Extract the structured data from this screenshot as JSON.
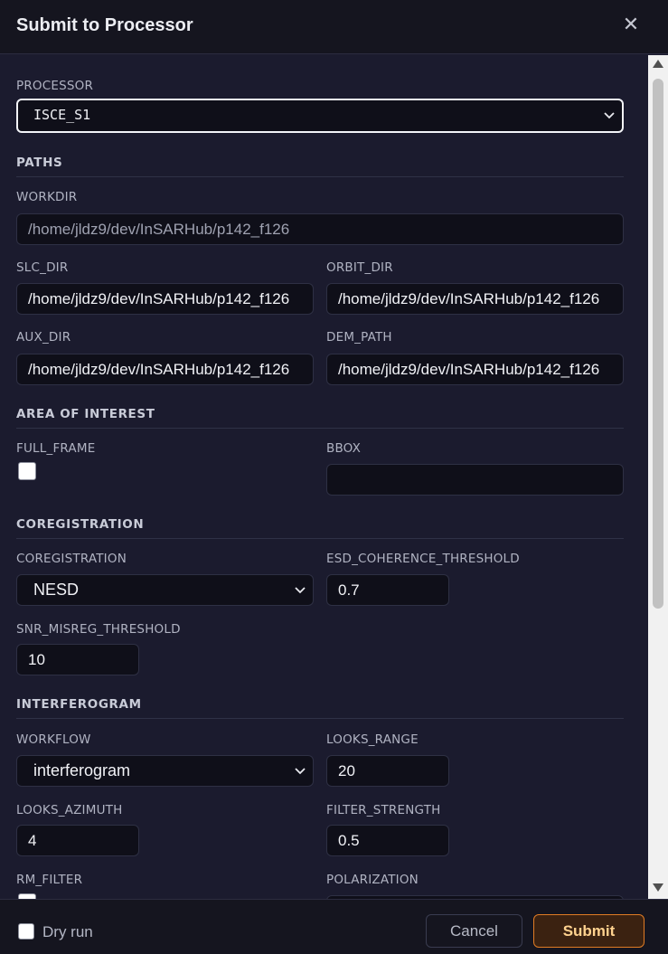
{
  "dialog": {
    "title": "Submit to Processor",
    "close_glyph": "✕"
  },
  "processor": {
    "label": "PROCESSOR",
    "selected": "ISCE_S1"
  },
  "paths": {
    "heading": "PATHS",
    "workdir_label": "WORKDIR",
    "workdir_placeholder": "/home/jldz9/dev/InSARHub/p142_f126",
    "slc_dir_label": "SLC_DIR",
    "slc_dir_value": "/home/jldz9/dev/InSARHub/p142_f126",
    "orbit_dir_label": "ORBIT_DIR",
    "orbit_dir_value": "/home/jldz9/dev/InSARHub/p142_f126",
    "aux_dir_label": "AUX_DIR",
    "aux_dir_value": "/home/jldz9/dev/InSARHub/p142_f126",
    "dem_path_label": "DEM_PATH",
    "dem_path_value": "/home/jldz9/dev/InSARHub/p142_f126"
  },
  "aoi": {
    "heading": "AREA OF INTEREST",
    "full_frame_label": "FULL_FRAME",
    "bbox_label": "BBOX",
    "bbox_value": ""
  },
  "coreg": {
    "heading": "COREGISTRATION",
    "coregistration_label": "COREGISTRATION",
    "coregistration_selected": "NESD",
    "esd_label": "ESD_COHERENCE_THRESHOLD",
    "esd_value": "0.7",
    "snr_label": "SNR_MISREG_THRESHOLD",
    "snr_value": "10"
  },
  "ifg": {
    "heading": "INTERFEROGRAM",
    "workflow_label": "WORKFLOW",
    "workflow_selected": "interferogram",
    "looks_range_label": "LOOKS_RANGE",
    "looks_range_value": "20",
    "looks_azimuth_label": "LOOKS_AZIMUTH",
    "looks_azimuth_value": "4",
    "filter_strength_label": "FILTER_STRENGTH",
    "filter_strength_value": "0.5",
    "rm_filter_label": "RM_FILTER",
    "polarization_label": "POLARIZATION"
  },
  "footer": {
    "dry_run_label": "Dry run",
    "cancel_label": "Cancel",
    "submit_label": "Submit"
  },
  "colors": {
    "background": "#1b1b2e",
    "header": "#15151f",
    "input_bg": "#0f0f19",
    "submit_border": "#e07c24",
    "submit_text": "#ffd28f"
  },
  "icons": {
    "close": "close-icon",
    "chevron": "chevron-down-icon"
  }
}
